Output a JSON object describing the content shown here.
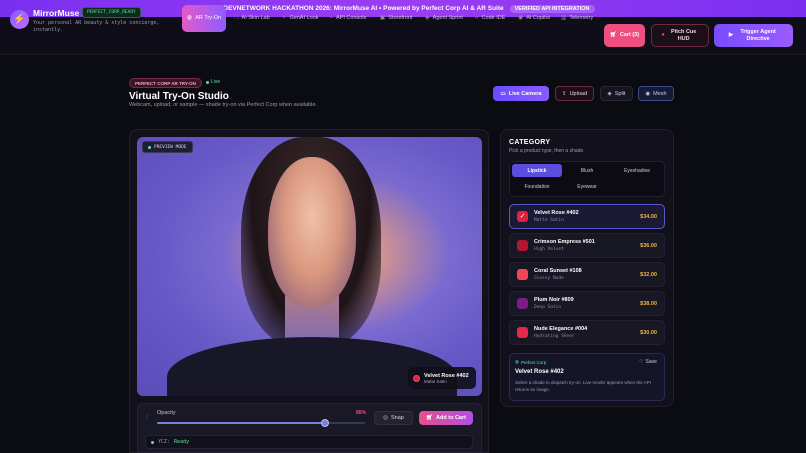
{
  "banner": {
    "text": "DEVNETWORK HACKATHON 2026: MirrorMuse AI • Powered by Perfect Corp AI & AR Suite",
    "pill": "VERIFIED API INTEGRATION"
  },
  "brand": {
    "name": "MirrorMuse AI",
    "badge": "PERFECT_CORP_READY",
    "tagline": "Your personal AR beauty & style concierge, instantly."
  },
  "nav": [
    {
      "label": "AR Try-On",
      "icon": "face-scan-icon",
      "active": true
    },
    {
      "label": "AI Skin Lab",
      "icon": "scan-icon",
      "active": false
    },
    {
      "label": "GenAI Look",
      "icon": "wand-icon",
      "active": false
    },
    {
      "label": "API Console",
      "icon": "terminal-icon",
      "active": false
    },
    {
      "label": "Storefront",
      "icon": "store-icon",
      "active": false
    },
    {
      "label": "Agent Sprint",
      "icon": "cube-icon",
      "active": false
    },
    {
      "label": "Code IDE",
      "icon": "code-icon",
      "active": false
    },
    {
      "label": "AI Copilot",
      "icon": "robot-icon",
      "active": false
    },
    {
      "label": "Telemetry",
      "icon": "chart-icon",
      "active": false
    }
  ],
  "header_buttons": {
    "cart": "Cart (3)",
    "pitch": "Pitch Cue HUD",
    "trigger": "Trigger Agent Directive"
  },
  "page": {
    "tag": "PERFECT CORP AR TRY-ON",
    "live": "Live",
    "title": "Virtual Try-On Studio",
    "subtitle": "Webcam, upload, or sample — shade try-on via Perfect Corp when available."
  },
  "actions": {
    "live_camera": "Live Camera",
    "upload": "Upload",
    "split": "Split",
    "mesh": "Mesh"
  },
  "preview": {
    "badge": "PREVIEW MODE",
    "chip_name": "Velvet Rose #402",
    "chip_sub": "Matte Satin"
  },
  "controls": {
    "opacity_label": "Opacity",
    "opacity_value": "85%",
    "opacity_fraction": 0.81,
    "snap": "Snap",
    "add_to_cart": "Add to Cart",
    "ycz_key": "YCZ:",
    "ycz_status": "Ready"
  },
  "category": {
    "title": "CATEGORY",
    "subtitle": "Pick a product type, then a shade.",
    "tabs": [
      "Lipstick",
      "Blush",
      "Eyeshadow",
      "Foundation",
      "Eyewear"
    ],
    "active_tab": 0
  },
  "shades": [
    {
      "name": "Velvet Rose #402",
      "finish": "Matte Satin",
      "price": "$34.00",
      "color": "#e0223f",
      "selected": true
    },
    {
      "name": "Crimson Empress #501",
      "finish": "High Velvet",
      "price": "$36.00",
      "color": "#b31532",
      "selected": false
    },
    {
      "name": "Coral Sunset #108",
      "finish": "Glossy Nude",
      "price": "$32.00",
      "color": "#f0465a",
      "selected": false
    },
    {
      "name": "Plum Noir #809",
      "finish": "Deep Satin",
      "price": "$38.00",
      "color": "#7a1e86",
      "selected": false
    },
    {
      "name": "Nude Elegance #004",
      "finish": "Hydrating Sheer",
      "price": "$30.00",
      "color": "#e3284b",
      "selected": false
    }
  ],
  "pc_card": {
    "brand": "Perfect Corp",
    "save": "Save",
    "title": "Velvet Rose #402",
    "desc": "Select a shade to dispatch try-on. Live render appears when the API returns an image."
  }
}
